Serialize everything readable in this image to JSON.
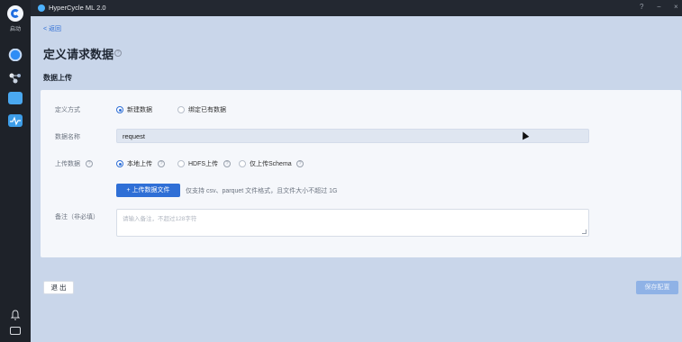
{
  "app": {
    "title": "HyperCycle ML 2.0"
  },
  "rail": {
    "start_label": "启动"
  },
  "window": {
    "help": "?",
    "minimize": "−",
    "close": "×"
  },
  "nav": {
    "back": "< 返回"
  },
  "page": {
    "title": "定义请求数据",
    "title_help": "?"
  },
  "section": {
    "title": "数据上传"
  },
  "form": {
    "define_method": {
      "label": "定义方式",
      "options": [
        "新建数据",
        "绑定已有数据"
      ],
      "selected": "新建数据"
    },
    "data_name": {
      "label": "数据名称",
      "value": "request"
    },
    "upload": {
      "label": "上传数据",
      "help": "?",
      "options": [
        "本地上传",
        "HDFS上传",
        "仅上传Schema"
      ],
      "option_help": [
        "?",
        "?",
        "?"
      ],
      "selected": "本地上传",
      "button": "+ 上传数据文件",
      "hint": "仅支持 csv、parquet 文件格式，且文件大小不超过 1G"
    },
    "remark": {
      "label": "备注（非必填）",
      "placeholder": "请输入备注，不超过128字符"
    }
  },
  "footer": {
    "exit": "退 出",
    "save": "保存配置"
  },
  "colors": {
    "primary": "#2f6fd6",
    "background": "#c9d6ea",
    "rail": "#1e2229"
  }
}
